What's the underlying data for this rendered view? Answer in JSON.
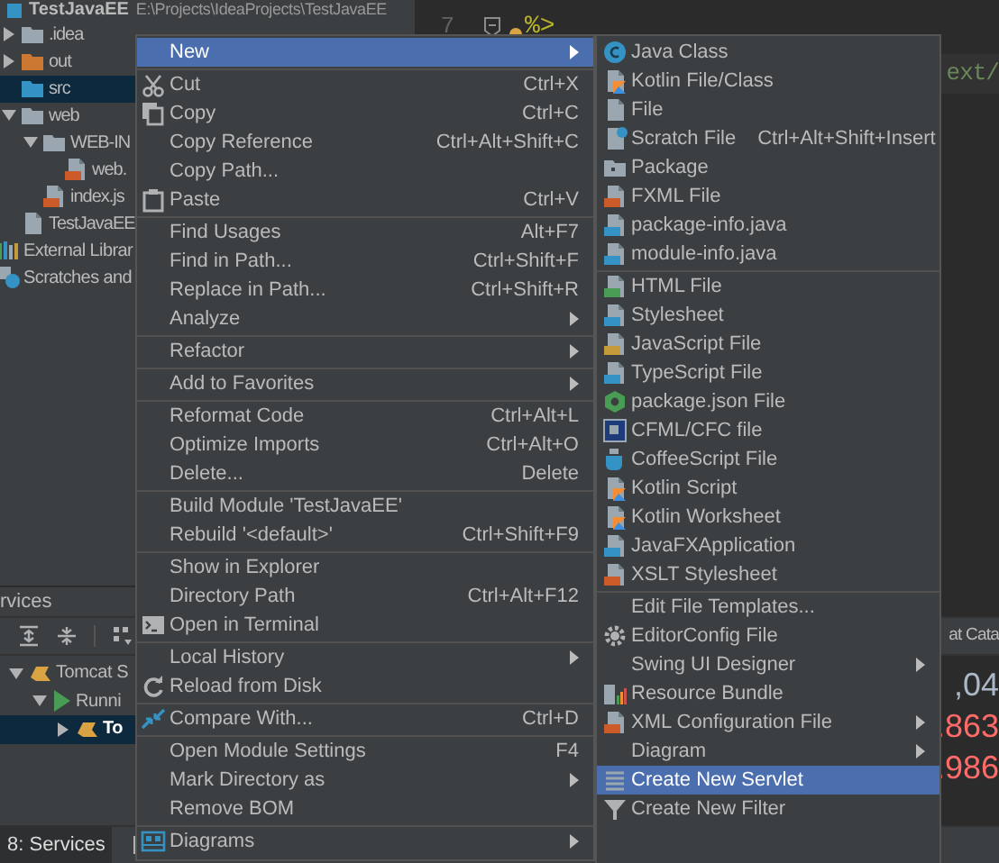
{
  "project": {
    "title": "TestJavaEE",
    "path": "E:\\Projects\\IdeaProjects\\TestJavaEE",
    "children": [
      {
        "label": ".idea",
        "expanded": false,
        "selected": false
      },
      {
        "label": "out",
        "expanded": false,
        "selected": false
      },
      {
        "label": "src",
        "selected": true
      },
      {
        "label": "web",
        "expanded": true,
        "selected": false,
        "children": [
          {
            "label": "WEB-IN",
            "expanded": true,
            "selected": false,
            "children": [
              {
                "label": "web.",
                "selected": false
              }
            ]
          },
          {
            "label": "index.js",
            "selected": false
          }
        ]
      },
      {
        "label": "TestJavaEE",
        "selected": false
      }
    ],
    "extras": [
      {
        "label": "External Librar",
        "selected": false
      },
      {
        "label": "Scratches and",
        "selected": false
      }
    ]
  },
  "editor": {
    "line_number": "7",
    "code": "%>",
    "code_right": "ext/"
  },
  "services": {
    "title": "rvices",
    "tree": [
      {
        "label": "Tomcat S",
        "expanded": true,
        "selected": false,
        "children": [
          {
            "label": "Runni",
            "expanded": true,
            "selected": false,
            "children": [
              {
                "label": "To",
                "expanded": false,
                "selected": true
              }
            ]
          }
        ]
      }
    ],
    "console": {
      "header": "at Cata",
      "values": [
        {
          "text": ",04",
          "kind": "normal"
        },
        {
          "text": ".863",
          "kind": "error"
        },
        {
          "text": ".986",
          "kind": "error"
        }
      ]
    }
  },
  "bottom_bar": {
    "tabs": [
      {
        "label": "8: Services",
        "selected": true
      }
    ]
  },
  "context_menu": {
    "groups": [
      {
        "items": [
          {
            "label": "New",
            "submenu": true,
            "selected": true
          }
        ]
      },
      {
        "items": [
          {
            "label": "Cut",
            "shortcut": "Ctrl+X",
            "selected": false
          },
          {
            "label": "Copy",
            "shortcut": "Ctrl+C",
            "selected": false
          },
          {
            "label": "Copy Reference",
            "shortcut": "Ctrl+Alt+Shift+C",
            "selected": false
          },
          {
            "label": "Copy Path...",
            "selected": false
          },
          {
            "label": "Paste",
            "shortcut": "Ctrl+V",
            "selected": false
          }
        ]
      },
      {
        "items": [
          {
            "label": "Find Usages",
            "shortcut": "Alt+F7",
            "selected": false
          },
          {
            "label": "Find in Path...",
            "shortcut": "Ctrl+Shift+F",
            "selected": false
          },
          {
            "label": "Replace in Path...",
            "shortcut": "Ctrl+Shift+R",
            "selected": false
          },
          {
            "label": "Analyze",
            "submenu": true,
            "selected": false
          }
        ]
      },
      {
        "items": [
          {
            "label": "Refactor",
            "submenu": true,
            "selected": false
          }
        ]
      },
      {
        "items": [
          {
            "label": "Add to Favorites",
            "submenu": true,
            "selected": false
          }
        ]
      },
      {
        "items": [
          {
            "label": "Reformat Code",
            "shortcut": "Ctrl+Alt+L",
            "selected": false
          },
          {
            "label": "Optimize Imports",
            "shortcut": "Ctrl+Alt+O",
            "selected": false
          },
          {
            "label": "Delete...",
            "shortcut": "Delete",
            "selected": false
          }
        ]
      },
      {
        "items": [
          {
            "label": "Build Module 'TestJavaEE'",
            "selected": false
          },
          {
            "label": "Rebuild '<default>'",
            "shortcut": "Ctrl+Shift+F9",
            "selected": false
          }
        ]
      },
      {
        "items": [
          {
            "label": "Show in Explorer",
            "selected": false
          },
          {
            "label": "Directory Path",
            "shortcut": "Ctrl+Alt+F12",
            "selected": false
          },
          {
            "label": "Open in Terminal",
            "selected": false
          }
        ]
      },
      {
        "items": [
          {
            "label": "Local History",
            "submenu": true,
            "selected": false
          },
          {
            "label": "Reload from Disk",
            "selected": false
          }
        ]
      },
      {
        "items": [
          {
            "label": "Compare With...",
            "shortcut": "Ctrl+D",
            "selected": false
          }
        ]
      },
      {
        "items": [
          {
            "label": "Open Module Settings",
            "shortcut": "F4",
            "selected": false
          },
          {
            "label": "Mark Directory as",
            "submenu": true,
            "selected": false
          },
          {
            "label": "Remove BOM",
            "selected": false
          }
        ]
      },
      {
        "items": [
          {
            "label": "Diagrams",
            "submenu": true,
            "selected": false
          }
        ]
      }
    ]
  },
  "submenu": {
    "groups": [
      {
        "items": [
          {
            "label": "Java Class",
            "selected": false
          },
          {
            "label": "Kotlin File/Class",
            "selected": false
          },
          {
            "label": "File",
            "selected": false
          },
          {
            "label": "Scratch File",
            "shortcut": "Ctrl+Alt+Shift+Insert",
            "selected": false
          },
          {
            "label": "Package",
            "selected": false
          },
          {
            "label": "FXML File",
            "selected": false
          },
          {
            "label": "package-info.java",
            "selected": false
          },
          {
            "label": "module-info.java",
            "selected": false
          }
        ]
      },
      {
        "items": [
          {
            "label": "HTML File",
            "selected": false
          },
          {
            "label": "Stylesheet",
            "selected": false
          },
          {
            "label": "JavaScript File",
            "selected": false
          },
          {
            "label": "TypeScript File",
            "selected": false
          },
          {
            "label": "package.json File",
            "selected": false
          },
          {
            "label": "CFML/CFC file",
            "selected": false
          },
          {
            "label": "CoffeeScript File",
            "selected": false
          },
          {
            "label": "Kotlin Script",
            "selected": false
          },
          {
            "label": "Kotlin Worksheet",
            "selected": false
          },
          {
            "label": "JavaFXApplication",
            "selected": false
          },
          {
            "label": "XSLT Stylesheet",
            "selected": false
          }
        ]
      },
      {
        "items": [
          {
            "label": "Edit File Templates...",
            "selected": false
          },
          {
            "label": "EditorConfig File",
            "selected": false
          },
          {
            "label": "Swing UI Designer",
            "submenu": true,
            "selected": false
          },
          {
            "label": "Resource Bundle",
            "selected": false
          },
          {
            "label": "XML Configuration File",
            "submenu": true,
            "selected": false
          },
          {
            "label": "Diagram",
            "submenu": true,
            "selected": false
          },
          {
            "label": "Create New Servlet",
            "selected": true
          },
          {
            "label": "Create New Filter",
            "selected": false
          }
        ]
      }
    ]
  }
}
